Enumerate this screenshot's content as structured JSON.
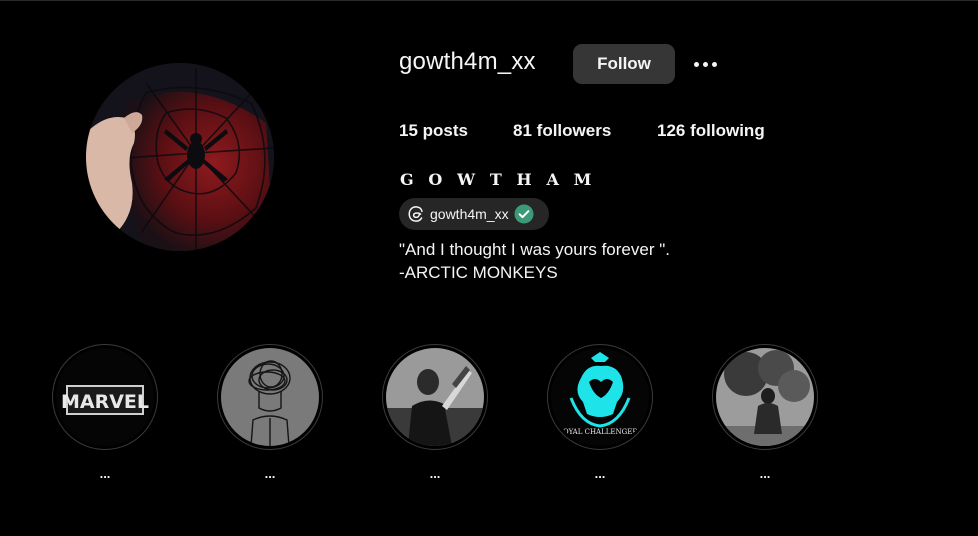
{
  "profile": {
    "username": "gowth4m_xx",
    "follow_label": "Follow",
    "full_name": "G O W T H A M",
    "threads_handle": "gowth4m_xx",
    "bio_lines": [
      "\"And I thought I was yours forever \".",
      "-ARCTIC MONKEYS"
    ]
  },
  "stats": {
    "posts_count": "15",
    "posts_label": "posts",
    "followers_count": "81",
    "followers_label": "followers",
    "following_count": "126",
    "following_label": "following"
  },
  "highlights": [
    {
      "label": "...",
      "cover_icon": "marvel-logo",
      "cover_text": "MARVEL"
    },
    {
      "label": "...",
      "cover_icon": "tangled-head-sketch",
      "cover_text": ""
    },
    {
      "label": "...",
      "cover_icon": "cricketer-photo",
      "cover_text": ""
    },
    {
      "label": "...",
      "cover_icon": "royal-challengers-logo",
      "cover_text": "ROYAL CHALLENGERS"
    },
    {
      "label": "...",
      "cover_icon": "person-tree-photo",
      "cover_text": ""
    }
  ],
  "colors": {
    "background": "#000000",
    "button_bg": "#363636",
    "badge_bg": "#262626",
    "verified_green": "#3d9a78",
    "rcb_cyan": "#1ee3e8"
  },
  "icons": {
    "avatar": "spider-man-suit-photo",
    "more": "more-options-icon",
    "threads": "threads-icon",
    "verified": "verified-check-icon"
  }
}
